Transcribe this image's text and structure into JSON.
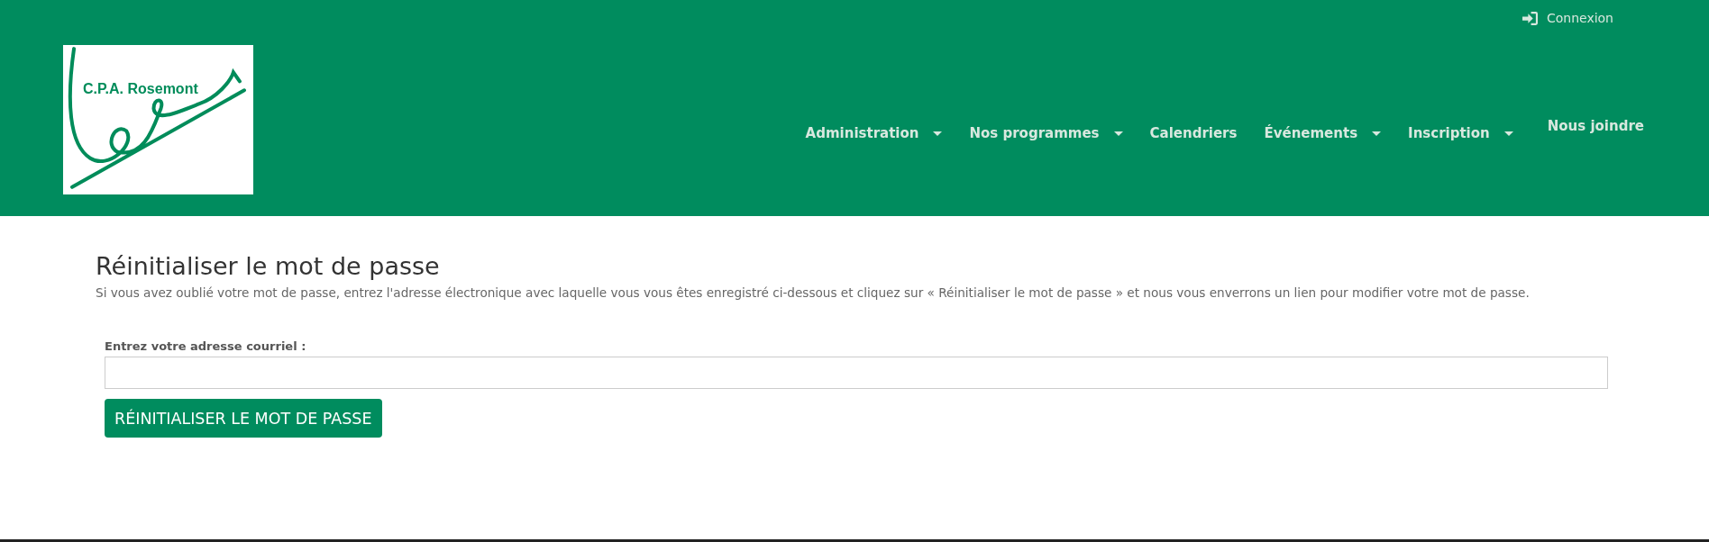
{
  "header": {
    "login_link": "Connexion",
    "logo_text": "C.P.A. Rosemont",
    "nav": [
      {
        "label": "Administration",
        "has_dropdown": true
      },
      {
        "label": "Nos programmes",
        "has_dropdown": true
      },
      {
        "label": "Calendriers",
        "has_dropdown": false
      },
      {
        "label": "Événements",
        "has_dropdown": true
      },
      {
        "label": "Inscription",
        "has_dropdown": true
      },
      {
        "label": "Nous joindre",
        "has_dropdown": false
      }
    ]
  },
  "main": {
    "title": "Réinitialiser le mot de passe",
    "description": "Si vous avez oublié votre mot de passe, entrez l'adresse électronique avec laquelle vous vous êtes enregistré ci-dessous et cliquez sur « Réinitialiser le mot de passe » et nous vous enverrons un lien pour modifier votre mot de passe.",
    "field_label": "Entrez votre adresse courriel :",
    "submit_button": "RÉINITIALISER LE MOT DE PASSE"
  }
}
